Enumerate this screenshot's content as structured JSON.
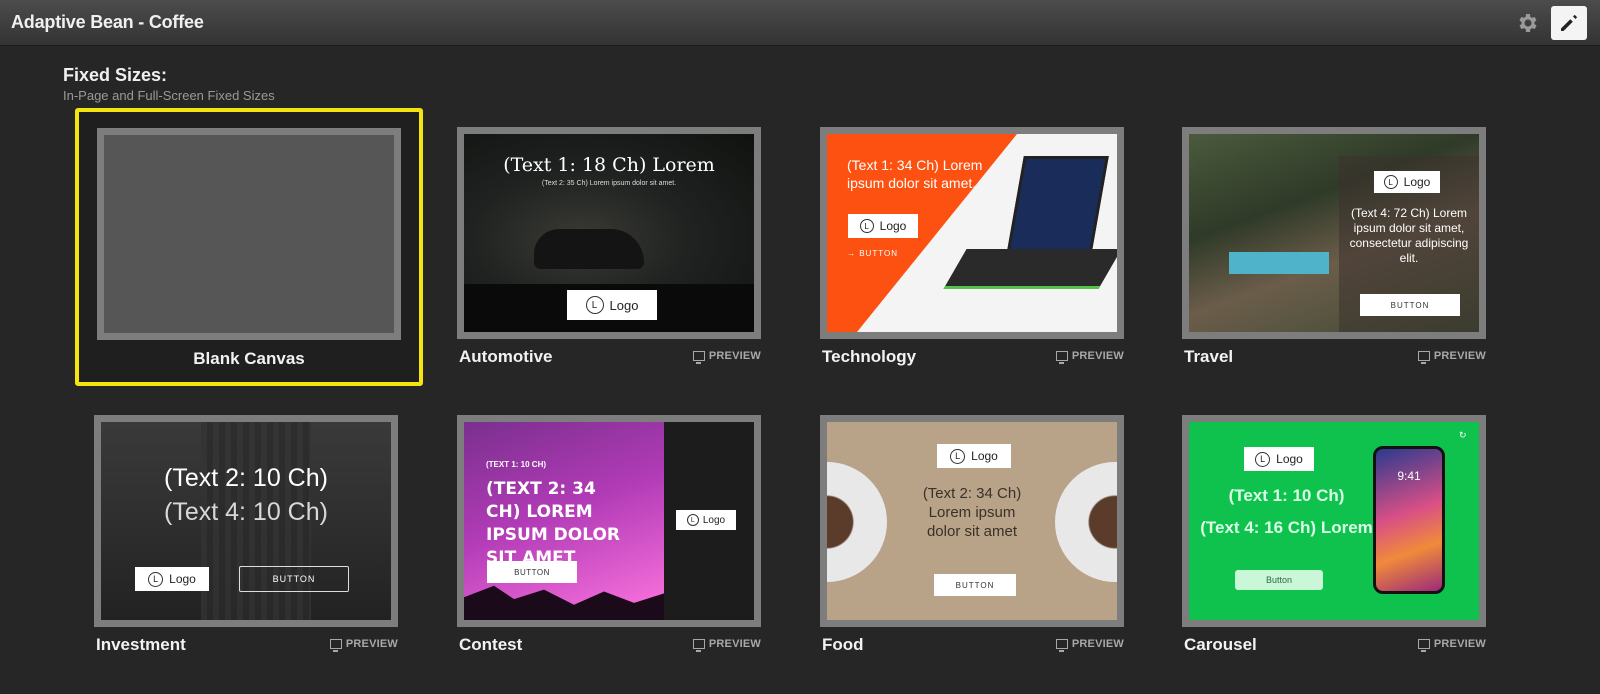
{
  "app": {
    "title": "Adaptive Bean - Coffee"
  },
  "section": {
    "title": "Fixed Sizes:",
    "subtitle": "In-Page and Full-Screen Fixed Sizes"
  },
  "preview_label": "PREVIEW",
  "templates": {
    "blank": {
      "label": "Blank Canvas"
    },
    "automotive": {
      "label": "Automotive",
      "text1": "(Text 1: 18 Ch) Lorem",
      "text2": "(Text 2: 35 Ch) Lorem ipsum dolor sit amet.",
      "logo": "Logo",
      "logo_mark": "L"
    },
    "technology": {
      "label": "Technology",
      "text1": "(Text 1: 34 Ch) Lorem ipsum dolor sit amet.",
      "logo": "Logo",
      "logo_mark": "L",
      "button": "→  BUTTON"
    },
    "travel": {
      "label": "Travel",
      "text4": "(Text 4: 72 Ch) Lorem ipsum dolor sit amet, consectetur adipiscing elit.",
      "logo": "Logo",
      "logo_mark": "L",
      "button": "BUTTON"
    },
    "investment": {
      "label": "Investment",
      "text2": "(Text 2: 10 Ch)",
      "text4": "(Text 4: 10 Ch)",
      "logo": "Logo",
      "logo_mark": "L",
      "button": "BUTTON"
    },
    "contest": {
      "label": "Contest",
      "text1": "(TEXT 1: 10 CH)",
      "text2": "(TEXT 2: 34 CH) LOREM IPSUM DOLOR SIT AMET",
      "logo": "Logo",
      "logo_mark": "L",
      "button": "BUTTON"
    },
    "food": {
      "label": "Food",
      "text2": "(Text 2: 34 Ch) Lorem ipsum dolor sit amet",
      "logo": "Logo",
      "logo_mark": "L",
      "button": "BUTTON"
    },
    "carousel": {
      "label": "Carousel",
      "text1": "(Text 1: 10 Ch)",
      "text4": "(Text 4: 16 Ch) Lorem",
      "logo": "Logo",
      "logo_mark": "L",
      "button": "Button",
      "phone_time": "9:41"
    }
  },
  "colors": {
    "selection": "#f5e50f",
    "tech_orange": "#fc5110",
    "carousel_green": "#0fc24e"
  }
}
